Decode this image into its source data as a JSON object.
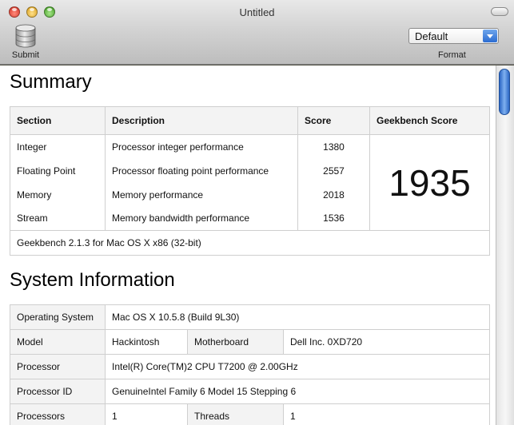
{
  "window": {
    "title": "Untitled"
  },
  "toolbar": {
    "submit_label": "Submit",
    "format_label": "Format",
    "format_value": "Default"
  },
  "summary": {
    "heading": "Summary",
    "headers": {
      "section": "Section",
      "description": "Description",
      "score": "Score",
      "geekbench": "Geekbench Score"
    },
    "rows": [
      {
        "section": "Integer",
        "description": "Processor integer performance",
        "score": "1380"
      },
      {
        "section": "Floating Point",
        "description": "Processor floating point performance",
        "score": "2557"
      },
      {
        "section": "Memory",
        "description": "Memory performance",
        "score": "2018"
      },
      {
        "section": "Stream",
        "description": "Memory bandwidth performance",
        "score": "1536"
      }
    ],
    "geekbench_score": "1935",
    "footer": "Geekbench 2.1.3 for Mac OS X x86 (32-bit)"
  },
  "system": {
    "heading": "System Information",
    "os_label": "Operating System",
    "os_value": "Mac OS X 10.5.8 (Build 9L30)",
    "model_label": "Model",
    "model_value": "Hackintosh",
    "motherboard_label": "Motherboard",
    "motherboard_value": "Dell Inc. 0XD720",
    "processor_label": "Processor",
    "processor_value": "Intel(R) Core(TM)2 CPU T7200 @ 2.00GHz",
    "processor_id_label": "Processor ID",
    "processor_id_value": "GenuineIntel Family 6 Model 15 Stepping 6",
    "processors_label": "Processors",
    "processors_value": "1",
    "threads_label": "Threads",
    "threads_value": "1"
  },
  "colors": {
    "scroll_thumb": "#2c67c5",
    "select_arrow": "#2b6cd1"
  }
}
